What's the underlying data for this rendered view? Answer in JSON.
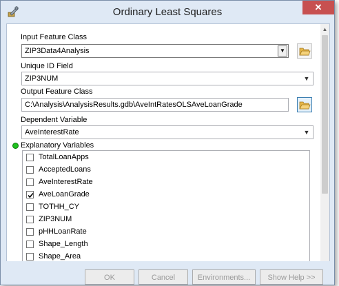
{
  "window": {
    "title": "Ordinary Least Squares",
    "close_glyph": "✕"
  },
  "form": {
    "input_feature_class": {
      "label": "Input Feature Class",
      "value": "ZIP3Data4Analysis"
    },
    "unique_id_field": {
      "label": "Unique ID Field",
      "value": "ZIP3NUM"
    },
    "output_feature_class": {
      "label": "Output Feature Class",
      "value": "C:\\Analysis\\AnalysisResults.gdb\\AveIntRatesOLSAveLoanGrade"
    },
    "dependent_variable": {
      "label": "Dependent Variable",
      "value": "AveInterestRate"
    },
    "explanatory_variables": {
      "label": "Explanatory Variables",
      "items": [
        {
          "label": "TotalLoanApps",
          "checked": false
        },
        {
          "label": "AcceptedLoans",
          "checked": false
        },
        {
          "label": "AveInterestRate",
          "checked": false
        },
        {
          "label": "AveLoanGrade",
          "checked": true
        },
        {
          "label": "TOTHH_CY",
          "checked": false
        },
        {
          "label": "ZIP3NUM",
          "checked": false
        },
        {
          "label": "pHHLoanRate",
          "checked": false
        },
        {
          "label": "Shape_Length",
          "checked": false
        },
        {
          "label": "Shape_Area",
          "checked": false
        }
      ]
    }
  },
  "buttons": {
    "ok": "OK",
    "cancel": "Cancel",
    "environments": "Environments...",
    "show_help": "Show Help >>"
  },
  "colors": {
    "window_bg": "#dfe9f5",
    "close_red": "#c75050",
    "required_dot": "#1fc11f"
  }
}
